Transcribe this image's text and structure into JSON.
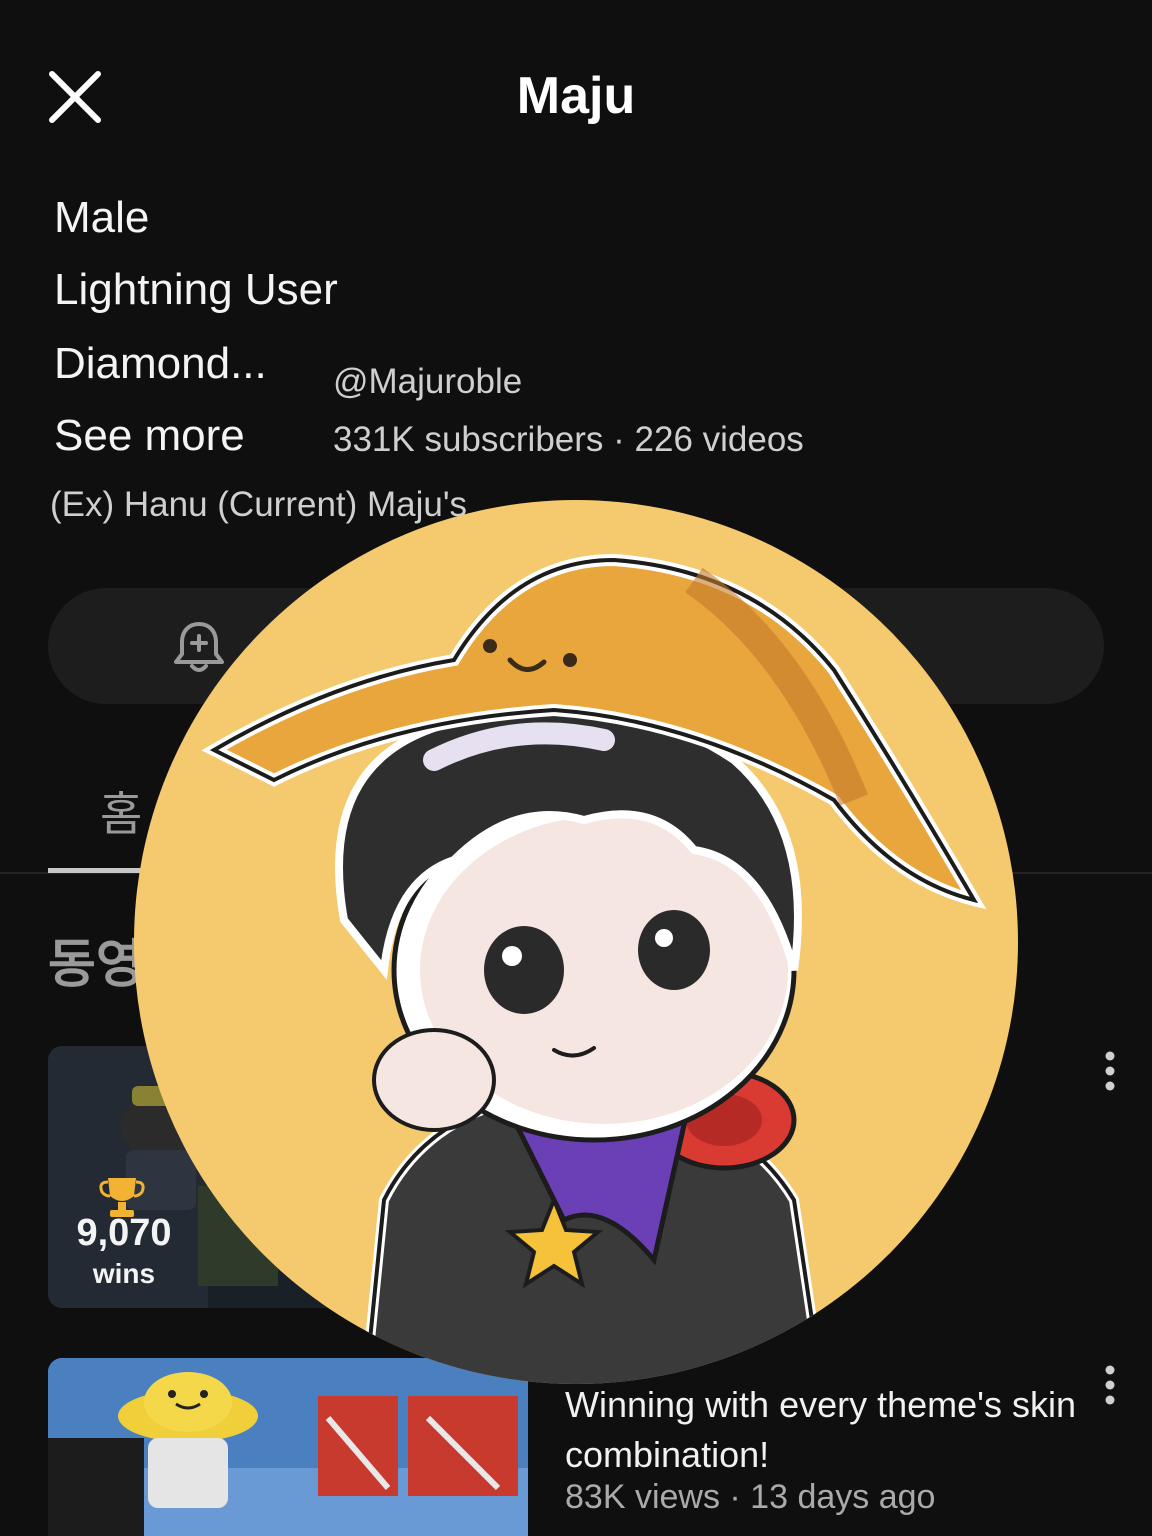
{
  "header": {
    "title": "Maju",
    "close_icon": "close-icon"
  },
  "about": {
    "bio_lines": [
      "Male",
      "Lightning User",
      "Diamond..."
    ],
    "see_more": "See more",
    "tagline": "(Ex) Hanu (Current) Maju's"
  },
  "channel": {
    "handle": "@Majuroble",
    "stats": "331K subscribers · 226 videos"
  },
  "actions": {
    "bell_icon": "notification-bell-icon"
  },
  "tabs": {
    "visible_label": "홈"
  },
  "section": {
    "label": "동영"
  },
  "videos": [
    {
      "thumb_stat_value": "9,070",
      "thumb_stat_label": "wins",
      "thumb_icon": "trophy-icon"
    },
    {
      "title": "Winning with every theme's skin combination!",
      "meta": "83K views · 13 days ago"
    }
  ],
  "overlay": {
    "avatar": "channel-avatar-image"
  },
  "colors": {
    "background": "#0f0f0f",
    "avatar_bg": "#f5c96e",
    "hat": "#e8a63c"
  }
}
